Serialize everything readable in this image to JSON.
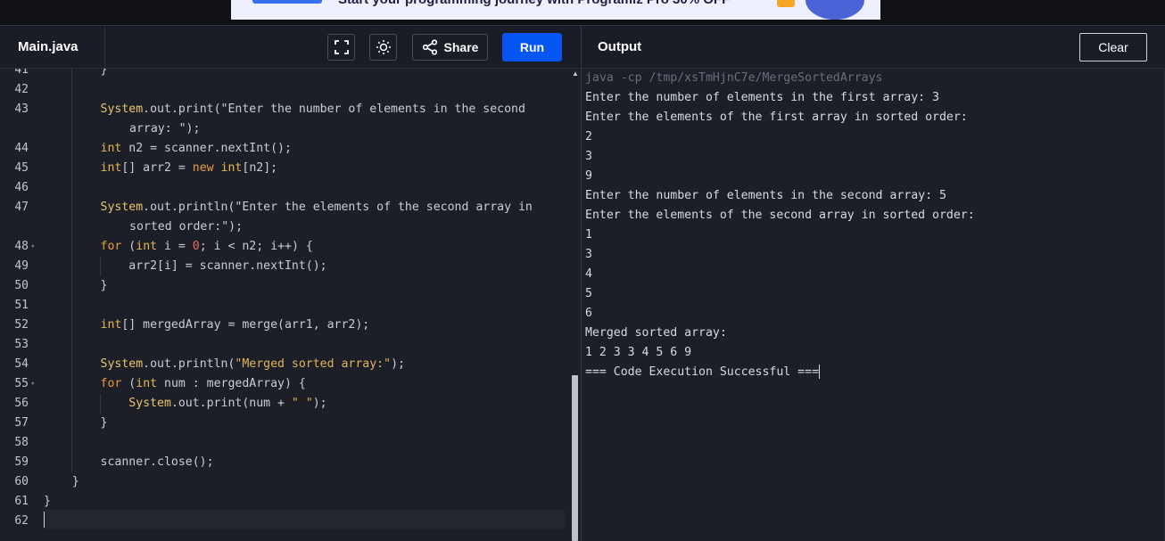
{
  "banner": {
    "text": "Start your programming journey with Programiz Pro 30% OFF",
    "brand_color": "#0556f3"
  },
  "editor": {
    "tab_label": "Main.java",
    "icons": [
      "fullscreen-icon",
      "theme-sun-icon",
      "share-icon"
    ],
    "share_label": "Share",
    "run_label": "Run",
    "code_lines": [
      {
        "n": "41",
        "text": "        }"
      },
      {
        "n": "42",
        "text": ""
      },
      {
        "n": "43",
        "text": "        System.out.print(\"Enter the number of elements in the second",
        "cont": "array: \");"
      },
      {
        "n": "44",
        "text": "        int n2 = scanner.nextInt();"
      },
      {
        "n": "45",
        "text": "        int[] arr2 = new int[n2];"
      },
      {
        "n": "46",
        "text": ""
      },
      {
        "n": "47",
        "text": "        System.out.println(\"Enter the elements of the second array in",
        "cont": "sorted order:\");"
      },
      {
        "n": "48",
        "text": "        for (int i = 0; i < n2; i++) {"
      },
      {
        "n": "49",
        "text": "            arr2[i] = scanner.nextInt();"
      },
      {
        "n": "50",
        "text": "        }"
      },
      {
        "n": "51",
        "text": ""
      },
      {
        "n": "52",
        "text": "        int[] mergedArray = merge(arr1, arr2);"
      },
      {
        "n": "53",
        "text": ""
      },
      {
        "n": "54",
        "text": "        System.out.println(\"Merged sorted array:\");"
      },
      {
        "n": "55",
        "text": "        for (int num : mergedArray) {"
      },
      {
        "n": "56",
        "text": "            System.out.print(num + \" \");"
      },
      {
        "n": "57",
        "text": "        }"
      },
      {
        "n": "58",
        "text": ""
      },
      {
        "n": "59",
        "text": "        scanner.close();"
      },
      {
        "n": "60",
        "text": "    }"
      },
      {
        "n": "61",
        "text": "}"
      },
      {
        "n": "62",
        "text": ""
      }
    ]
  },
  "output": {
    "title": "Output",
    "clear_label": "Clear",
    "command": "java -cp /tmp/xsTmHjnC7e/MergeSortedArrays",
    "lines": [
      "Enter the number of elements in the first array: 3",
      "Enter the elements of the first array in sorted order:",
      "2",
      "3",
      "9",
      "Enter the number of elements in the second array: 5",
      "Enter the elements of the second array in sorted order:",
      "1",
      "3",
      "4",
      "5",
      "6",
      "Merged sorted array:",
      "1 2 3 3 4 5 6 9",
      "=== Code Execution Successful ==="
    ]
  }
}
